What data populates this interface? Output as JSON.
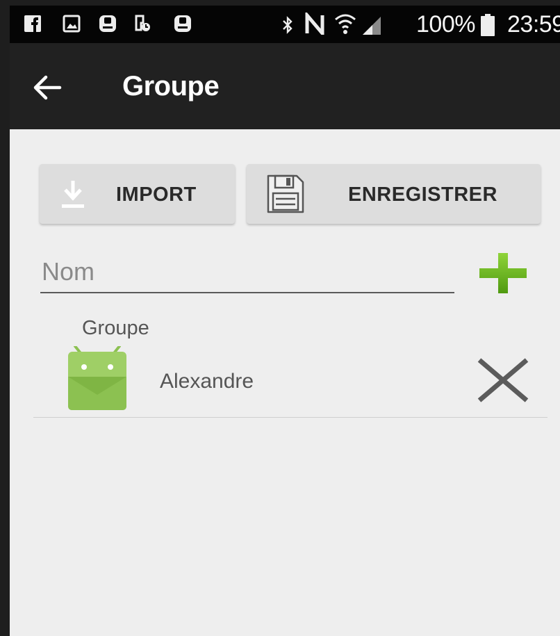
{
  "status_bar": {
    "icons": [
      "facebook-icon",
      "gallery-icon",
      "notification-icon",
      "media-icon",
      "notification-icon",
      "bluetooth-icon",
      "nfc-icon",
      "wifi-icon",
      "cell-signal-icon",
      "battery-icon"
    ],
    "battery": "100%",
    "time": "23:59"
  },
  "app_bar": {
    "title": "Groupe",
    "back_icon": "arrow-back-icon"
  },
  "actions": {
    "import_label": "IMPORT",
    "save_label": "ENREGISTRER"
  },
  "name_field": {
    "placeholder": "Nom",
    "value": ""
  },
  "group": {
    "label": "Groupe",
    "members": [
      {
        "name": "Alexandre",
        "avatar_icon": "android-icon"
      }
    ]
  },
  "colors": {
    "status_bar": "#050505",
    "app_bar": "#212121",
    "background": "#eeeeee",
    "button": "#dddddd",
    "accent_green": "#6aa81e",
    "android_green": "#8cc151",
    "remove_gray": "#5b5b5b"
  }
}
